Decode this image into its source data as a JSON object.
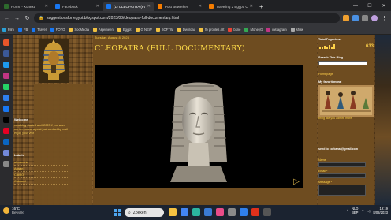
{
  "browser": {
    "tabs": [
      {
        "label": "Home - Xonext",
        "color": "#2d6a2d",
        "active": false
      },
      {
        "label": "Facebook",
        "color": "#1877f2",
        "active": false
      },
      {
        "label": "(1) CLEOPATRA (FULL DO...",
        "color": "#1877f2",
        "active": true
      },
      {
        "label": "Post Bewerken",
        "color": "#f57c00",
        "active": false
      },
      {
        "label": "Traveling 2 Egypt: CL...",
        "color": "#f57c00",
        "active": false
      }
    ],
    "url": "suggestionsfor egypt.blogspot.com/2023/08/cleopatra-full-documentary.html",
    "bookmarks": [
      {
        "label": "Film",
        "color": "#2a9fd6"
      },
      {
        "label": "FB",
        "color": "#1877f2"
      },
      {
        "label": "Travel",
        "color": "#1877f2"
      },
      {
        "label": "FOTO",
        "color": "#1877f2"
      },
      {
        "label": "SocMedia",
        "color": "#f0c040"
      },
      {
        "label": "Algemeen",
        "color": "#f0c040"
      },
      {
        "label": "Egypt",
        "color": "#f0c040"
      },
      {
        "label": "G NEW",
        "color": "#f0c040"
      },
      {
        "label": "SOFTW",
        "color": "#f0c040"
      },
      {
        "label": "Dwnload",
        "color": "#f0c040"
      },
      {
        "label": "fb profiles art",
        "color": "#f0c040"
      },
      {
        "label": "bsne",
        "color": "#ea4335"
      },
      {
        "label": "MoneyG",
        "color": "#34a853"
      },
      {
        "label": "instagram",
        "color": "#c13584"
      },
      {
        "label": "shak",
        "color": "#aaaaaa"
      }
    ]
  },
  "blog": {
    "post_date": "Tuesday, August 8, 2023",
    "post_title": "CLEOPATRA (FULL DOCUMENTARY)",
    "welcome": {
      "heading": "Welcome",
      "text": "new blog started april 2023 if you want me to remove a post just contact by mail enjoy your visit"
    },
    "labels": {
      "heading": "Labels",
      "items": [
        "alexandria",
        "Aswan",
        "CAIRO",
        "Cobraed"
      ]
    },
    "sidebar": {
      "pageviews_heading": "Total Pageviews",
      "pageviews_count": "633",
      "search_heading": "Search This Blog",
      "homepage_link": "Homepage",
      "favorite_heading": "My favorit mural",
      "favorite_caption": "bring like you admire more",
      "contact_email": "send to corbanai@gmail.com",
      "form": {
        "name_label": "Name",
        "email_label": "Email *",
        "message_label": "Message *"
      }
    }
  },
  "taskbar": {
    "weather_temp": "16°C",
    "weather_desc": "Bewolkt",
    "search_label": "Zoeken",
    "lang_line1": "NLD",
    "lang_line2": "BEP",
    "time": "19:19",
    "date": "8/08/2023",
    "apps": [
      {
        "name": "file-explorer-icon",
        "color": "#f5c242"
      },
      {
        "name": "chrome-icon",
        "color": "#4285f4"
      },
      {
        "name": "edge-icon",
        "color": "#2bb5a0"
      },
      {
        "name": "store-icon",
        "color": "#3a7bd5"
      },
      {
        "name": "photos-icon",
        "color": "#ea4c89"
      },
      {
        "name": "settings-icon",
        "color": "#8a8a8a"
      },
      {
        "name": "mail-icon",
        "color": "#2f80ed"
      },
      {
        "name": "opera-icon",
        "color": "#e0311b"
      },
      {
        "name": "terminal-icon",
        "color": "#555555"
      }
    ]
  },
  "rail_apps": [
    {
      "name": "app-icon-1",
      "color": "#e8562a"
    },
    {
      "name": "app-icon-2",
      "color": "#3b5998"
    },
    {
      "name": "app-icon-3",
      "color": "#1d9bf0"
    },
    {
      "name": "app-icon-4",
      "color": "#c13584"
    },
    {
      "name": "app-icon-5",
      "color": "#25d366"
    },
    {
      "name": "app-icon-6",
      "color": "#2f80ed"
    },
    {
      "name": "app-icon-7",
      "color": "#1877f2"
    },
    {
      "name": "app-icon-8",
      "color": "#000000"
    },
    {
      "name": "app-icon-9",
      "color": "#e60023"
    },
    {
      "name": "app-icon-10",
      "color": "#0a66c2"
    },
    {
      "name": "app-icon-11",
      "color": "#7289da"
    },
    {
      "name": "app-icon-12",
      "color": "#888888"
    }
  ]
}
